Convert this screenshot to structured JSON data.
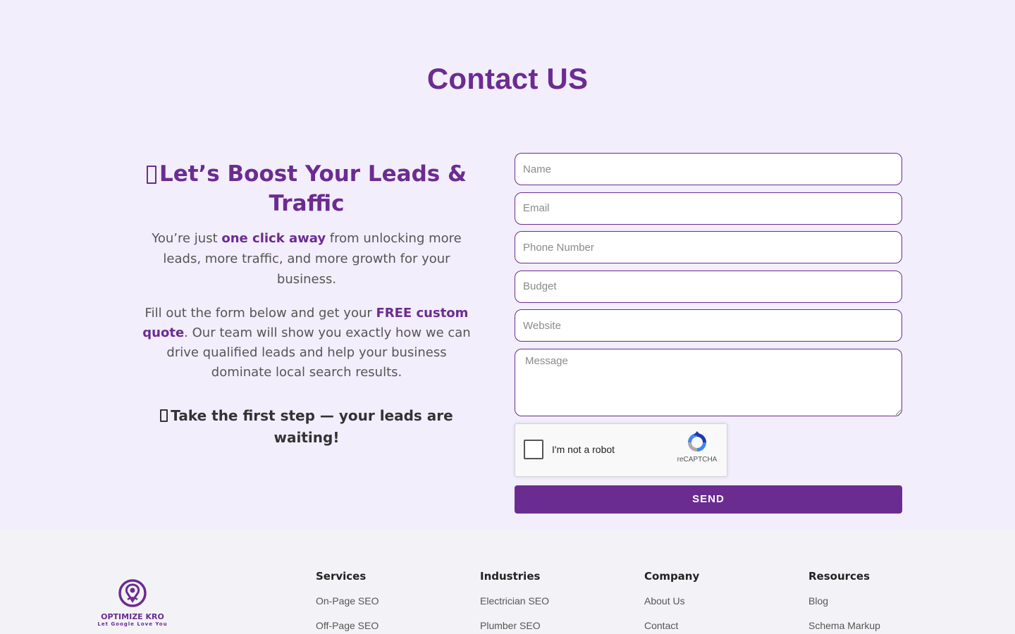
{
  "contact": {
    "title": "Contact US",
    "heading": "Let’s Boost Your Leads & Traffic",
    "para1": {
      "before": "You’re just ",
      "highlight": "one click away",
      "after": " from unlocking more leads, more traffic, and more growth for your business."
    },
    "para2": {
      "before": "Fill out the form below and get your ",
      "highlight": "FREE custom quote",
      "after": ". Our team will show you exactly how we can drive qualified leads and help your business dominate local search results."
    },
    "cta": "Take the first step — your leads are waiting!"
  },
  "form": {
    "name_placeholder": "Name",
    "email_placeholder": "Email",
    "phone_placeholder": "Phone Number",
    "budget_placeholder": "Budget",
    "website_placeholder": "Website",
    "message_placeholder": "Message",
    "recaptcha_label": "I'm not a robot",
    "recaptcha_brand": "reCAPTCHA",
    "send_label": "SEND"
  },
  "footer": {
    "brand_name": "OPTIMIZE KRO",
    "brand_tagline": "Let Google Love You",
    "columns": [
      {
        "title": "Services",
        "items": [
          "On-Page SEO",
          "Off-Page SEO"
        ]
      },
      {
        "title": "Industries",
        "items": [
          "Electrician SEO",
          "Plumber SEO"
        ]
      },
      {
        "title": "Company",
        "items": [
          "About Us",
          "Contact"
        ]
      },
      {
        "title": "Resources",
        "items": [
          "Blog",
          "Schema Markup"
        ]
      }
    ]
  },
  "colors": {
    "brand_purple": "#6b2c91",
    "page_background": "#f2eefc",
    "footer_background": "#f3f3f7"
  },
  "icons": {
    "heading_glyph": "missing-emoji-box-icon",
    "cta_glyph": "missing-emoji-box-icon",
    "recaptcha": "recaptcha-logo-icon",
    "footer_logo": "optimize-kro-logo"
  }
}
